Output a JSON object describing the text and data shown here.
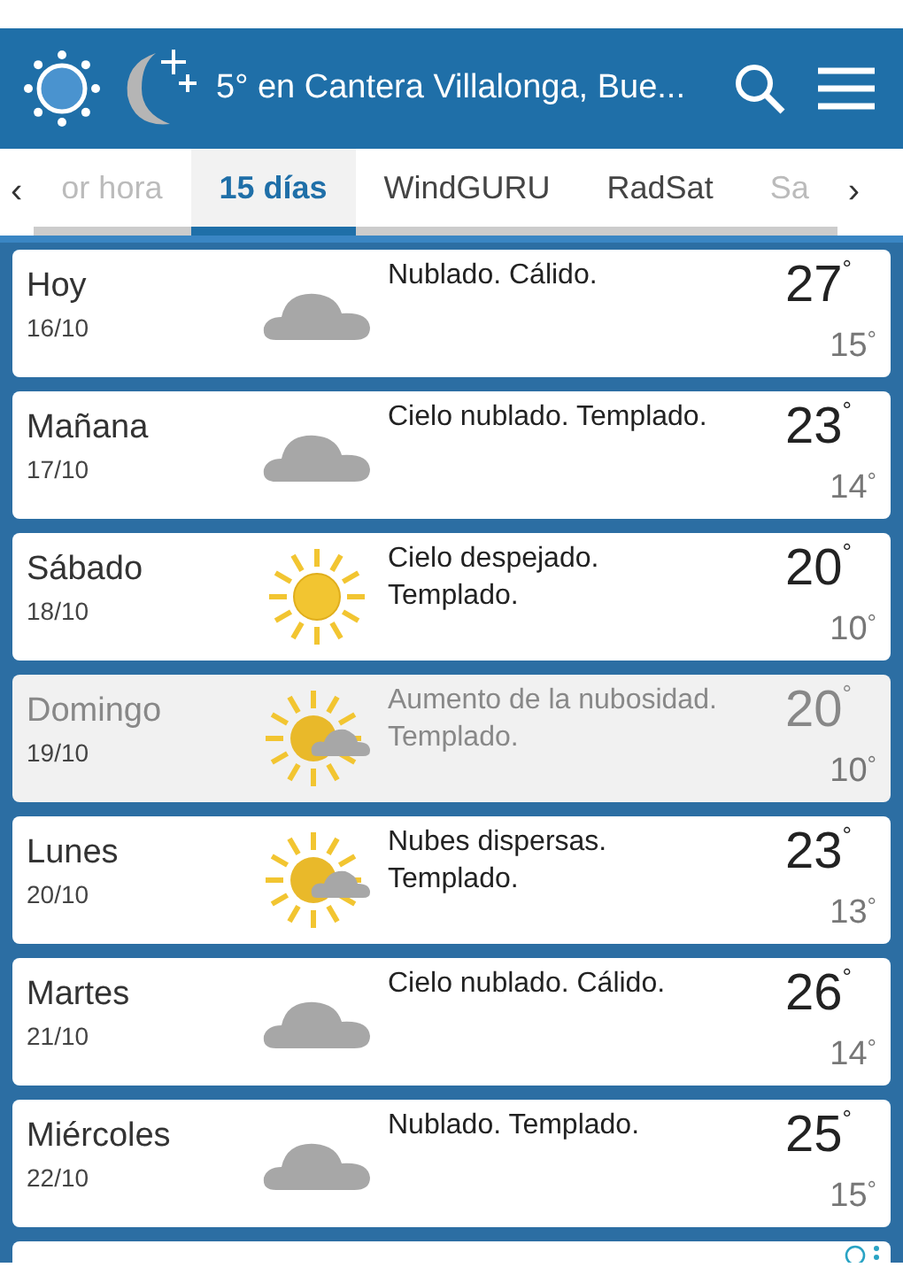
{
  "header": {
    "title": "5° en Cantera Villalonga, Bue..."
  },
  "tab_arrows": {
    "left": "‹",
    "right": "›"
  },
  "tabs": [
    {
      "label": "or hora",
      "selected": false,
      "faded": true
    },
    {
      "label": "15 días",
      "selected": true,
      "faded": false
    },
    {
      "label": "WindGURU",
      "selected": false,
      "faded": false
    },
    {
      "label": "RadSat",
      "selected": false,
      "faded": false
    },
    {
      "label": "Sa",
      "selected": false,
      "faded": true
    }
  ],
  "days": [
    {
      "day": "Hoy",
      "date": "16/10",
      "kind": "cloud",
      "summary": "Nublado. Cálido.",
      "max": "27$^{°}$",
      "min": "15$^{°}$",
      "dimmed": false
    },
    {
      "day": "Mañana",
      "date": "17/10",
      "kind": "cloud",
      "summary": "Cielo nublado. Templado.",
      "max": "23$^{°}$",
      "min": "14$^{°}$",
      "dimmed": false
    },
    {
      "day": "Sábado",
      "date": "18/10",
      "kind": "sun",
      "summary": "Cielo despejado. Templado.",
      "max": "20$^{°}$",
      "min": "10$^{°}$",
      "dimmed": false
    },
    {
      "day": "Domingo",
      "date": "19/10",
      "kind": "sun-cloud",
      "summary": "Aumento de la nubosidad. Templado.",
      "max": "20$^{°}$",
      "min": "10$^{°}$",
      "dimmed": true
    },
    {
      "day": "Lunes",
      "date": "20/10",
      "kind": "sun-cloud",
      "summary": "Nubes dispersas. Templado.",
      "max": "23$^{°}$",
      "min": "13$^{°}$",
      "dimmed": false
    },
    {
      "day": "Martes",
      "date": "21/10",
      "kind": "cloud",
      "summary": "Cielo nublado. Cálido.",
      "max": "26$^{°}$",
      "min": "14$^{°}$",
      "dimmed": false
    },
    {
      "day": "Miércoles",
      "date": "22/10",
      "kind": "cloud",
      "summary": "Nublado. Templado.",
      "max": "25$^{°}$",
      "min": "15$^{°}$",
      "dimmed": false
    }
  ]
}
